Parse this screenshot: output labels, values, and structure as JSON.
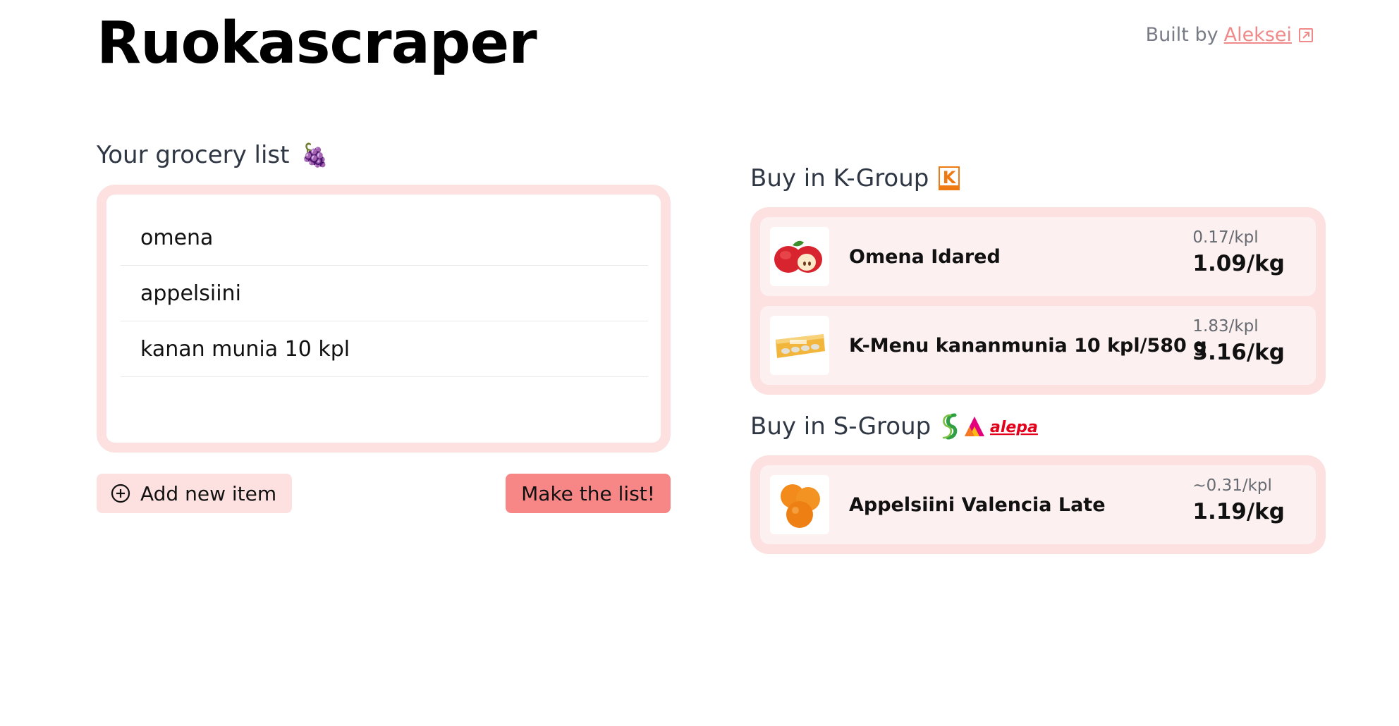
{
  "header": {
    "title": "Ruokascraper",
    "built_by_prefix": "Built by",
    "author_link": "Aleksei"
  },
  "grocery": {
    "heading": "Your grocery list",
    "heading_icon": "grapes-icon",
    "items": [
      "omena",
      "appelsiini",
      "kanan munia 10 kpl"
    ],
    "add_label": "Add new item",
    "make_label": "Make the list!"
  },
  "k_group": {
    "heading": "Buy in K-Group",
    "logo": "K",
    "products": [
      {
        "name": "Omena Idared",
        "price_unit": "0.17/kpl",
        "price_kg": "1.09/kg",
        "icon": "apple-icon"
      },
      {
        "name": "K-Menu kananmunia 10 kpl/580 g",
        "price_unit": "1.83/kpl",
        "price_kg": "3.16/kg",
        "icon": "egg-carton-icon"
      }
    ]
  },
  "s_group": {
    "heading": "Buy in S-Group",
    "logo_text": "alepa",
    "products": [
      {
        "name": "Appelsiini Valencia Late",
        "price_unit": "~0.31/kpl",
        "price_kg": "1.19/kg",
        "icon": "orange-icon"
      }
    ]
  },
  "colors": {
    "accent_light": "#fde0e0",
    "accent": "#f78787",
    "card_bg": "#fdf0f0",
    "k_orange": "#f07a12",
    "alepa_red": "#e3001b"
  }
}
